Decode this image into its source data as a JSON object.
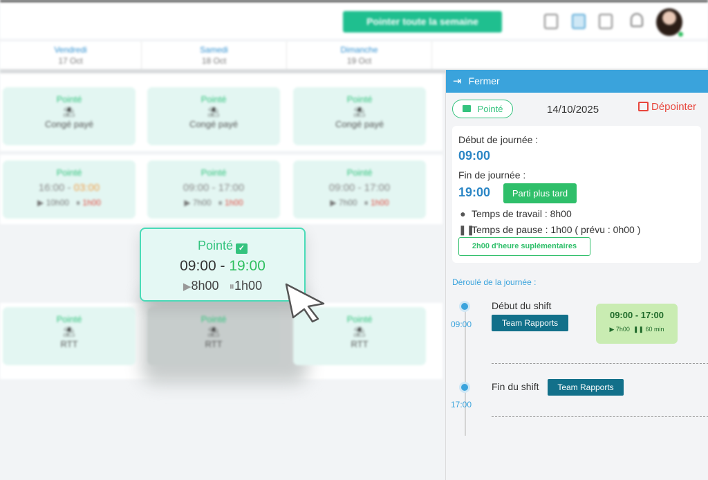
{
  "topbar": {
    "week_button_label": "Pointer toute la semaine",
    "icons": [
      "calendar-print-icon",
      "calendar-icon",
      "calendar-alt-icon",
      "bell-icon"
    ],
    "avatar": "user-avatar"
  },
  "days": [
    {
      "name": "Vendredi",
      "date": "17 Oct"
    },
    {
      "name": "Samedi",
      "date": "18 Oct"
    },
    {
      "name": "Dimanche",
      "date": "19 Oct"
    }
  ],
  "rows": [
    {
      "cells": [
        {
          "status": "Pointé",
          "label": "Congé payé"
        },
        {
          "status": "Pointé",
          "label": "Congé payé"
        },
        {
          "status": "Pointé",
          "label": "Congé payé"
        }
      ]
    },
    {
      "cells": [
        {
          "status": "Pointé",
          "start": "16:00",
          "end": "03:00",
          "work": "10h00",
          "pause": "1h00"
        },
        {
          "status": "Pointé",
          "start": "09:00",
          "end": "17:00",
          "work": "7h00",
          "pause": "1h00"
        },
        {
          "status": "Pointé",
          "start": "09:00",
          "end": "17:00",
          "work": "7h00",
          "pause": "1h00"
        }
      ]
    },
    {
      "cells": [
        {
          "status": "Pointé",
          "label": "RTT"
        },
        {
          "status": "Pointé",
          "label": "RTT"
        },
        {
          "status": "Pointé",
          "label": "RTT"
        }
      ]
    }
  ],
  "focus_card": {
    "status": "Pointé",
    "start": "09:00",
    "separator": " - ",
    "end": "19:00",
    "work": "8h00",
    "pause": "1h00"
  },
  "panel": {
    "close_label": "Fermer",
    "status_pill": "Pointé",
    "date": "14/10/2025",
    "unpoint_label": "Dépointer",
    "start_label": "Début de journée :",
    "start_value": "09:00",
    "end_label": "Fin de journée :",
    "end_value": "19:00",
    "late_badge": "Parti plus tard",
    "work_time": "Temps de travail : 8h00",
    "pause_time": "Temps de pause : 1h00 ( prévu : 0h00 )",
    "overtime_badge": "2h00 d'heure suplémentaires",
    "timeline_title": "Déroulé de la journée :",
    "timeline": [
      {
        "time": "09:00",
        "title": "Début du shift",
        "team": "Team Rapports"
      },
      {
        "time": "17:00",
        "title": "Fin du shift",
        "team": "Team Rapports"
      }
    ],
    "shift_card": {
      "range": "09:00 - 17:00",
      "work": "7h00",
      "pause": "60 min"
    }
  },
  "colors": {
    "accent": "#3aa3dc",
    "success": "#2fbf6a",
    "danger": "#e8453c",
    "team": "#12708a"
  }
}
